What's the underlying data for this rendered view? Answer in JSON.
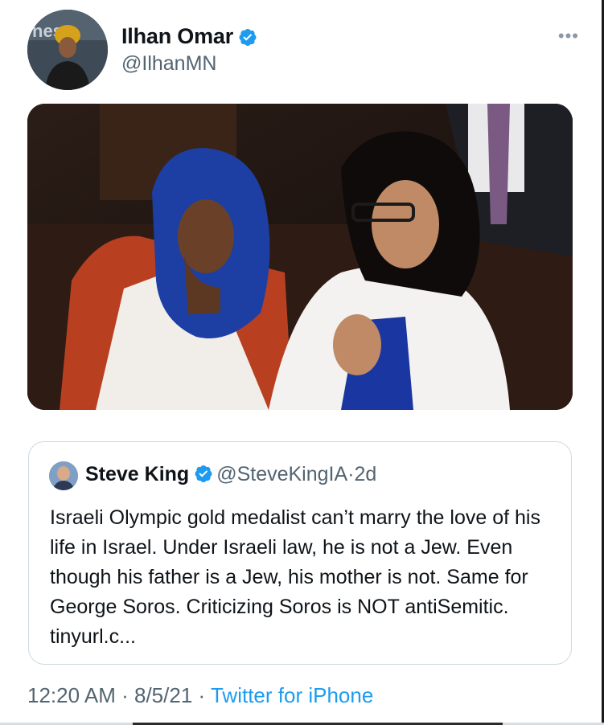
{
  "tweet": {
    "author": {
      "display_name": "Ilhan Omar",
      "handle": "@IlhanMN",
      "verified": true,
      "avatar_icon": "user-avatar"
    },
    "more_icon": "more-dots-icon",
    "media": {
      "description_icon": "photo"
    },
    "quoted_tweet": {
      "author": {
        "display_name": "Steve King",
        "handle": "@SteveKingIA",
        "separator": "·",
        "age": "2d",
        "verified": true
      },
      "text": "Israeli Olympic gold medalist can’t marry the love of his life in Israel. Under Israeli law, he is not a Jew. Even though his father is a Jew, his mother is not. Same for George Soros. Criticizing Soros is NOT antiSemitic.  tinyurl.c..."
    },
    "meta": {
      "time": "12:20 AM",
      "sep1": "·",
      "date": "8/5/21",
      "sep2": "·",
      "source": "Twitter for iPhone"
    }
  },
  "colors": {
    "verified": "#1d9bf0",
    "secondary_text": "#536471",
    "link": "#1d9bf0",
    "border": "#cfd9de"
  }
}
